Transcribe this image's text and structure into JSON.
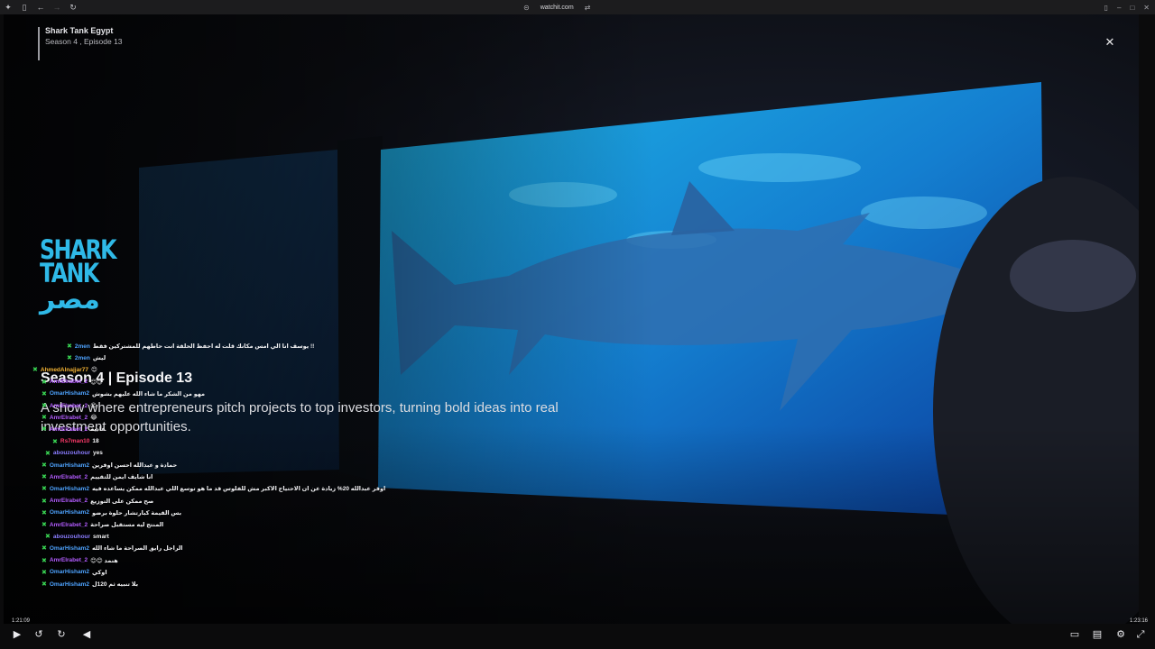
{
  "browser": {
    "url": "watchit.com",
    "icons": [
      "app-icon",
      "sidebar-icon",
      "back-icon",
      "forward-icon",
      "reload-icon",
      "link-icon",
      "swap-icon",
      "panel-icon",
      "minimize-icon",
      "maximize-icon",
      "close-window-icon"
    ]
  },
  "episode": {
    "show": "Shark Tank Egypt",
    "season_episode": "Season 4 , Episode 13",
    "title": "Season 4  |  Episode 13",
    "description": "A show where entrepreneurs pitch projects to top investors, turning bold ideas into real investment opportunities."
  },
  "logo": {
    "line1": "SHARK",
    "line2": "TANK",
    "line3": "مصر"
  },
  "chat": [
    {
      "user": "2men",
      "user_color": "#4ea3ff",
      "text": "يوسف انا الي امس مكانك قلت له احفظ الحلقة انت حاطهم للمشتركين فقط !!"
    },
    {
      "user": "2men",
      "user_color": "#4ea3ff",
      "text": "ليش"
    },
    {
      "user": "AhmedAlnajjar77",
      "user_color": "#f2b233",
      "text": "😊"
    },
    {
      "user": "AmrElrabet_2",
      "user_color": "#b35cff",
      "text": "😊😊"
    },
    {
      "user": "OmarHisham2",
      "user_color": "#4ea3ff",
      "text": "مهو من الشكر ما شاء الله عليهم بشوش"
    },
    {
      "user": "AmrElrabet_2",
      "user_color": "#b35cff",
      "text": "😊"
    },
    {
      "user": "AmrElrabet_2",
      "user_color": "#b35cff",
      "text": "😂"
    },
    {
      "user": "AmrElrabet_2",
      "user_color": "#b35cff",
      "text": "عادية"
    },
    {
      "user": "Rs7man10",
      "user_color": "#ff3b6b",
      "text": "18"
    },
    {
      "user": "abouzouhour",
      "user_color": "#8a7cff",
      "text": "yes"
    },
    {
      "user": "OmarHisham2",
      "user_color": "#4ea3ff",
      "text": "حمادة و عبدالله احسن اوفرين"
    },
    {
      "user": "AmrElrabet_2",
      "user_color": "#b35cff",
      "text": "انا شايف ايمن للتقييم"
    },
    {
      "user": "OmarHisham2",
      "user_color": "#4ea3ff",
      "text": "اوفر عبدالله 20% زيادة عن ان الاحتياج الاكبر مش للفلوس قد ما هو توسع اللي عبدالله ممكن يساعده فيه"
    },
    {
      "user": "AmrElrabet_2",
      "user_color": "#b35cff",
      "text": "صح ممكن على التوزيع"
    },
    {
      "user": "OmarHisham2",
      "user_color": "#4ea3ff",
      "text": "بس القيمة كبارتشار حلوة برضو"
    },
    {
      "user": "AmrElrabet_2",
      "user_color": "#b35cff",
      "text": "المنتج ليه مستقبل صراحة"
    },
    {
      "user": "abouzouhour",
      "user_color": "#8a7cff",
      "text": "smart"
    },
    {
      "user": "OmarHisham2",
      "user_color": "#4ea3ff",
      "text": "الراجل رايق الصراحة ما شاء الله"
    },
    {
      "user": "AmrElrabet_2",
      "user_color": "#b35cff",
      "text": "😊😊 هنمد"
    },
    {
      "user": "OmarHisham2",
      "user_color": "#4ea3ff",
      "text": "اوكي"
    },
    {
      "user": "OmarHisham2",
      "user_color": "#4ea3ff",
      "text": "بلا تنبيه ثم 120ل"
    }
  ],
  "player": {
    "time_elapsed": "1:21:09",
    "time_total": "1:23:16",
    "controls": [
      "play-icon",
      "rewind-10-icon",
      "forward-10-icon",
      "volume-icon",
      "subtitles-icon",
      "episodes-icon",
      "settings-icon",
      "fullscreen-icon"
    ]
  }
}
